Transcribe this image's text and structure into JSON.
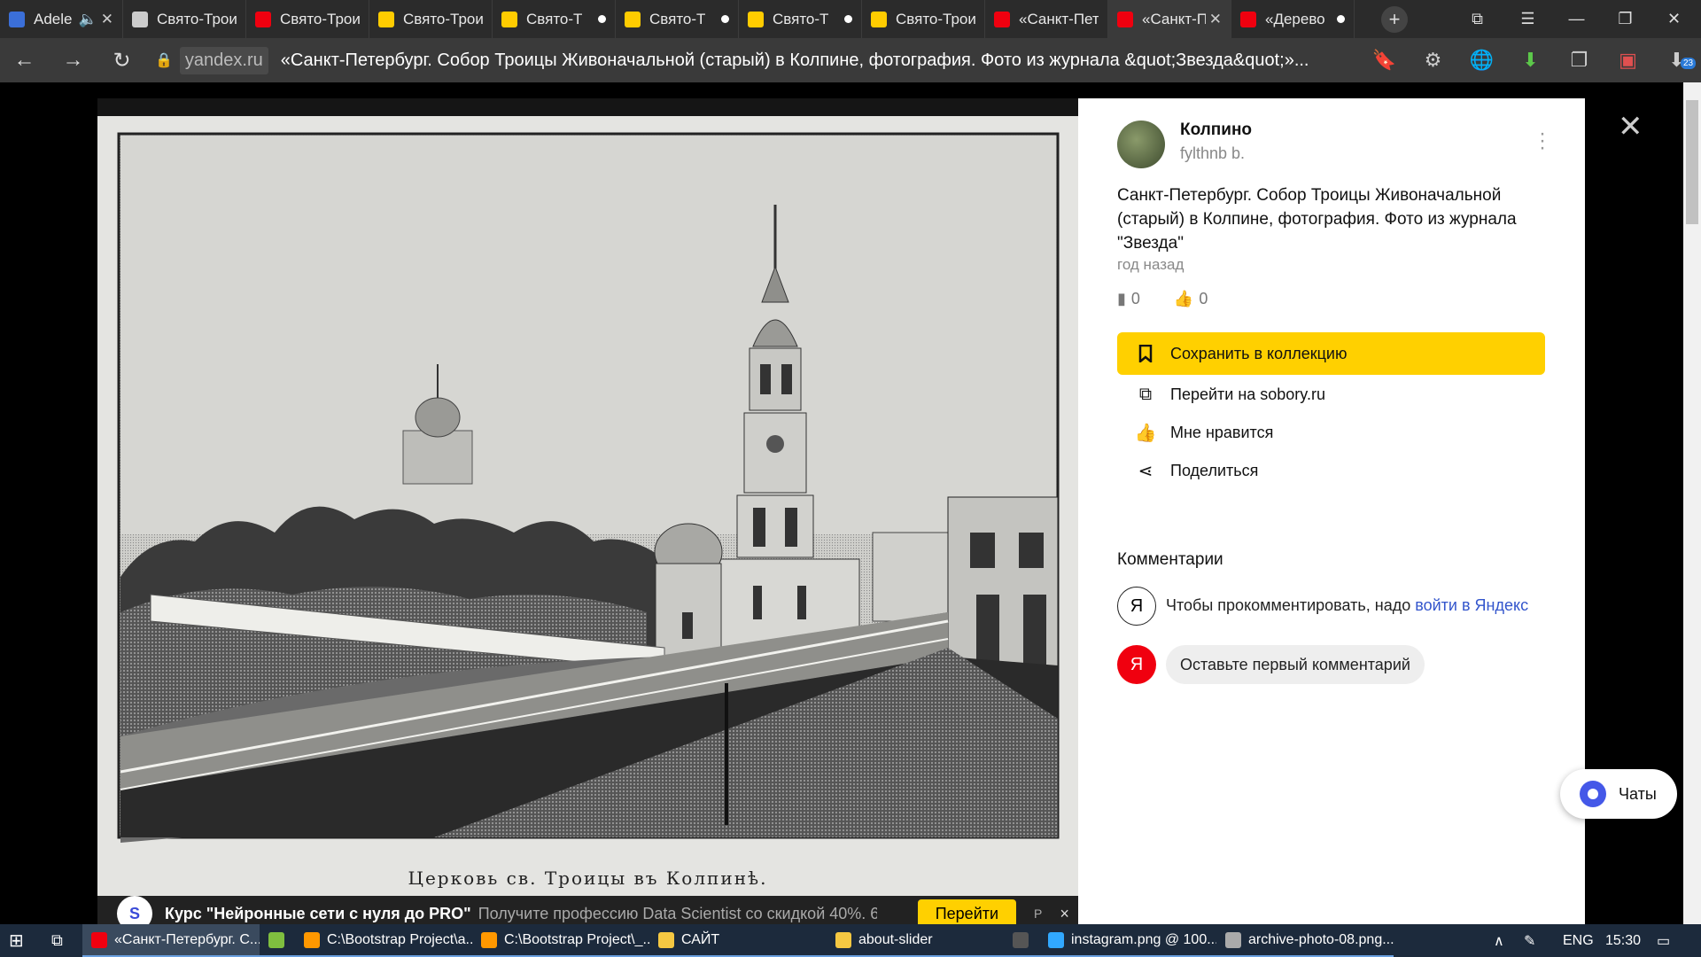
{
  "browser": {
    "tabs": [
      {
        "label": "Adele",
        "icon": "play-icon",
        "icon_color": "#3b6fd8",
        "muted": true,
        "closable": true
      },
      {
        "label": "Свято-Троиц",
        "icon": "page-icon",
        "icon_color": "#cccccc"
      },
      {
        "label": "Свято-Троиц",
        "icon": "yandex-icon",
        "icon_color": "#f0000f"
      },
      {
        "label": "Свято-Троиц",
        "icon": "yandex-images-icon",
        "icon_color": "#ffcc00"
      },
      {
        "label": "Свято-Т",
        "icon": "yandex-images-icon",
        "icon_color": "#ffcc00",
        "dot": true
      },
      {
        "label": "Свято-Т",
        "icon": "yandex-images-icon",
        "icon_color": "#ffcc00",
        "dot": true
      },
      {
        "label": "Свято-Т",
        "icon": "yandex-images-icon",
        "icon_color": "#ffcc00",
        "dot": true
      },
      {
        "label": "Свято-Троиц",
        "icon": "yandex-images-icon",
        "icon_color": "#ffcc00"
      },
      {
        "label": "«Санкт-Пет",
        "icon": "yandex-collections-icon",
        "icon_color": "#f0000f"
      },
      {
        "label": "«Санкт-П",
        "icon": "yandex-collections-icon",
        "icon_color": "#f0000f",
        "active": true,
        "closable": true
      },
      {
        "label": "«Дерево",
        "icon": "yandex-collections-icon",
        "icon_color": "#f0000f",
        "dot": true
      }
    ],
    "domain": "yandex.ru",
    "page_title": "«Санкт-Петербург. Собор Троицы Живоначальной (старый) в Колпине, фотография. Фото из журнала &quot;Звезда&quot;»...",
    "extension_badge": "23"
  },
  "photo": {
    "caption": "Церковь св. Троицы въ Колпинѣ."
  },
  "ad": {
    "logo_letter": "S",
    "title": "Курс \"Нейронные сети с нуля до PRO\"",
    "subtitle": "Получите профессию Data Scientist со скидкой 40%. 6...",
    "button": "Перейти",
    "marker": "Р",
    "close": "×"
  },
  "panel": {
    "author": "Колпино",
    "author_sub": "fylthnb b.",
    "description": "Санкт-Петербург. Собор Троицы Живоначальной (старый) в Колпине, фотография. Фото из журнала \"Звезда\"",
    "time": "год назад",
    "saves": "0",
    "likes": "0",
    "save_button": "Сохранить в коллекцию",
    "actions": {
      "goto": "Перейти на sobory.ru",
      "like": "Мне нравится",
      "share": "Поделиться"
    },
    "comments_heading": "Комментарии",
    "login_prefix": "Чтобы прокомментировать, надо ",
    "login_link": "войти в Яндекс",
    "first_comment": "Оставьте первый комментарий",
    "ya_letter": "Я"
  },
  "chats_button": "Чаты",
  "taskbar": {
    "apps": [
      {
        "label": "«Санкт-Петербург. С...",
        "icon": "yandex-browser-icon",
        "color": "#f0000f",
        "active": true
      },
      {
        "label": "",
        "icon": "notepad-icon",
        "color": "#7fbf3f"
      },
      {
        "label": "C:\\Bootstrap Project\\a...",
        "icon": "sublime-icon",
        "color": "#ff9800"
      },
      {
        "label": "C:\\Bootstrap Project\\_...",
        "icon": "sublime-icon",
        "color": "#ff9800"
      },
      {
        "label": "САЙТ",
        "icon": "folder-icon",
        "color": "#f5c842"
      },
      {
        "label": "about-slider",
        "icon": "folder-icon",
        "color": "#f5c842"
      },
      {
        "label": "",
        "icon": "calculator-icon",
        "color": "#555555"
      },
      {
        "label": "instagram.png @ 100...",
        "icon": "photoshop-icon",
        "color": "#31a8ff"
      },
      {
        "label": "archive-photo-08.png...",
        "icon": "paint-icon",
        "color": "#aaaaaa"
      }
    ],
    "language": "ENG",
    "time": "15:30"
  }
}
